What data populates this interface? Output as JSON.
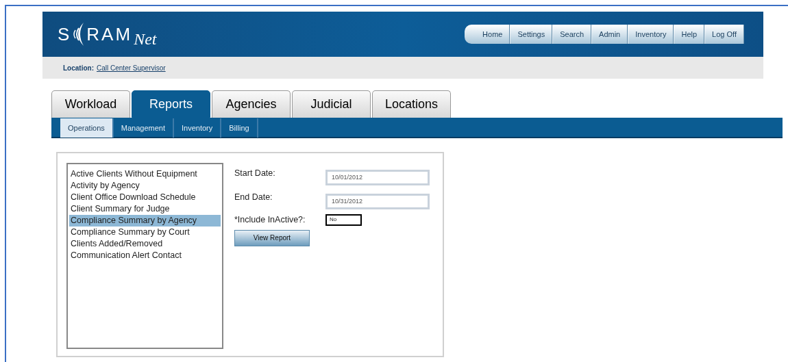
{
  "logo": {
    "left": "S",
    "right": "RAM",
    "script": "Net"
  },
  "nav": [
    "Home",
    "Settings",
    "Search",
    "Admin",
    "Inventory",
    "Help",
    "Log Off"
  ],
  "location": {
    "label": "Location:",
    "value": "Call Center Supervisor"
  },
  "tabs": [
    {
      "label": "Workload",
      "selected": false
    },
    {
      "label": "Reports",
      "selected": true
    },
    {
      "label": "Agencies",
      "selected": false
    },
    {
      "label": "Judicial",
      "selected": false
    },
    {
      "label": "Locations",
      "selected": false
    }
  ],
  "subtabs": [
    {
      "label": "Operations",
      "selected": true
    },
    {
      "label": "Management",
      "selected": false
    },
    {
      "label": "Inventory",
      "selected": false
    },
    {
      "label": "Billing",
      "selected": false
    }
  ],
  "reports": [
    {
      "label": "Active Clients Without Equipment",
      "selected": false
    },
    {
      "label": "Activity by Agency",
      "selected": false
    },
    {
      "label": "Client Office Download Schedule",
      "selected": false
    },
    {
      "label": "Client Summary for Judge",
      "selected": false
    },
    {
      "label": "Compliance Summary by Agency",
      "selected": true
    },
    {
      "label": "Compliance Summary by Court",
      "selected": false
    },
    {
      "label": "Clients Added/Removed",
      "selected": false
    },
    {
      "label": "Communication Alert Contact",
      "selected": false
    }
  ],
  "form": {
    "start_label": "Start Date:",
    "start_value": "10/01/2012",
    "end_label": "End Date:",
    "end_value": "10/31/2012",
    "inactive_label": "*Include InActive?:",
    "inactive_value": "No",
    "button": "View Report"
  }
}
